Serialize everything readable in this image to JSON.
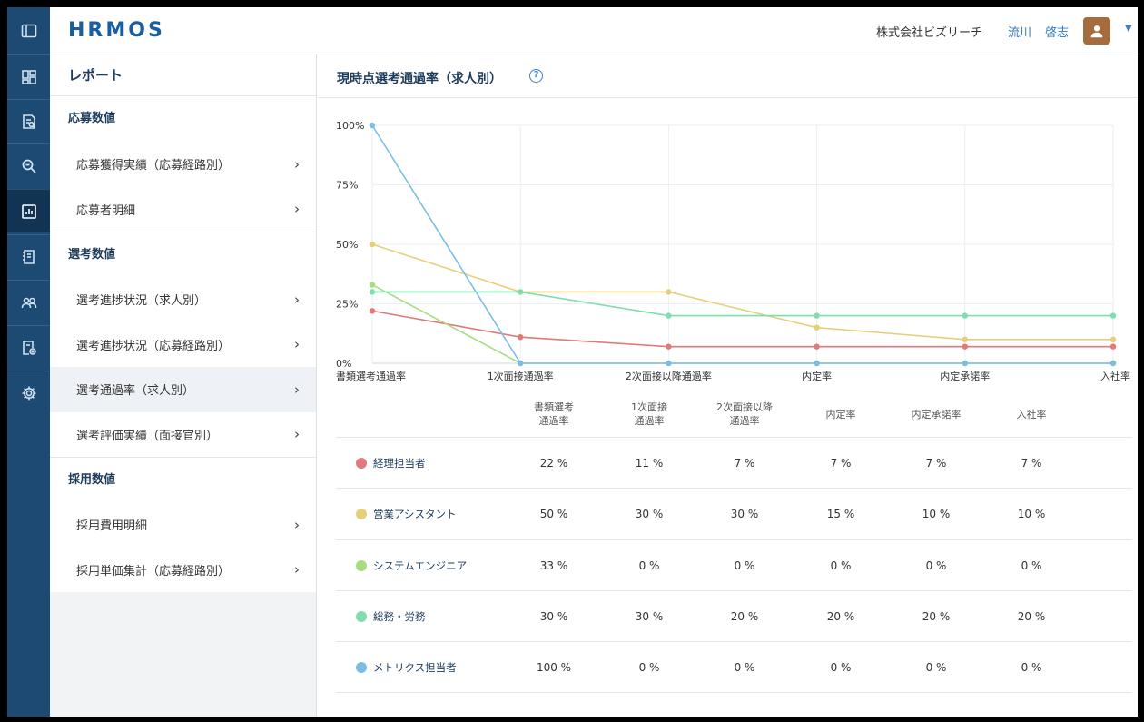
{
  "header": {
    "logo": "HRMOS",
    "company": "株式会社ビズリーチ",
    "user_last": "流川",
    "user_first": "啓志"
  },
  "rail": {
    "items": [
      "sidebar-toggle-icon",
      "dashboard-icon",
      "document-search-icon",
      "search-icon",
      "report-icon",
      "job-posting-icon",
      "people-icon",
      "settings-doc-icon",
      "gear-icon"
    ],
    "active_index": 4
  },
  "menu": {
    "title": "レポート",
    "sections": [
      {
        "heading": "応募数値",
        "items": [
          {
            "label": "応募獲得実績（応募経路別）"
          },
          {
            "label": "応募者明細"
          }
        ]
      },
      {
        "heading": "選考数値",
        "items": [
          {
            "label": "選考進捗状況（求人別）"
          },
          {
            "label": "選考進捗状況（応募経路別）"
          },
          {
            "label": "選考通過率（求人別）"
          },
          {
            "label": "選考評価実績（面接官別）"
          }
        ]
      },
      {
        "heading": "採用数値",
        "items": [
          {
            "label": "採用費用明細"
          },
          {
            "label": "採用単価集計（応募経路別）"
          }
        ]
      }
    ],
    "active_label": "選考通過率（求人別）"
  },
  "main": {
    "title": "現時点選考通過率（求人別）",
    "help": "?"
  },
  "chart_data": {
    "type": "line",
    "categories": [
      "書類選考通過率",
      "1次面接通過率",
      "2次面接以降通過率",
      "内定率",
      "内定承諾率",
      "入社率"
    ],
    "y_ticks": [
      "100%",
      "75%",
      "50%",
      "25%",
      "0%"
    ],
    "ylim": [
      0,
      100
    ],
    "grid": true,
    "series": [
      {
        "name": "経理担当者",
        "color": "#e07a7a",
        "values": [
          22,
          11,
          7,
          7,
          7,
          7
        ]
      },
      {
        "name": "営業アシスタント",
        "color": "#e6cf7a",
        "values": [
          50,
          30,
          30,
          15,
          10,
          10
        ]
      },
      {
        "name": "システムエンジニア",
        "color": "#a6dd7e",
        "values": [
          33,
          0,
          0,
          0,
          0,
          0
        ]
      },
      {
        "name": "総務・労務",
        "color": "#7fdeae",
        "values": [
          30,
          30,
          20,
          20,
          20,
          20
        ]
      },
      {
        "name": "メトリクス担当者",
        "color": "#7cbde6",
        "values": [
          100,
          0,
          0,
          0,
          0,
          0
        ]
      }
    ]
  },
  "table": {
    "headers": [
      [
        "書類選考",
        "通過率"
      ],
      [
        "1次面接",
        "通過率"
      ],
      [
        "2次面接以降",
        "通過率"
      ],
      [
        "内定率"
      ],
      [
        "内定承諾率"
      ],
      [
        "入社率"
      ]
    ],
    "rows": [
      {
        "name": "経理担当者",
        "color": "#e07a7a",
        "cells": [
          "22 %",
          "11 %",
          "7 %",
          "7 %",
          "7 %",
          "7 %"
        ]
      },
      {
        "name": "営業アシスタント",
        "color": "#e6cf7a",
        "cells": [
          "50 %",
          "30 %",
          "30 %",
          "15 %",
          "10 %",
          "10 %"
        ]
      },
      {
        "name": "システムエンジニア",
        "color": "#a6dd7e",
        "cells": [
          "33 %",
          "0 %",
          "0 %",
          "0 %",
          "0 %",
          "0 %"
        ]
      },
      {
        "name": "総務・労務",
        "color": "#7fdeae",
        "cells": [
          "30 %",
          "30 %",
          "20 %",
          "20 %",
          "20 %",
          "20 %"
        ]
      },
      {
        "name": "メトリクス担当者",
        "color": "#7cbde6",
        "cells": [
          "100 %",
          "0 %",
          "0 %",
          "0 %",
          "0 %",
          "0 %"
        ]
      }
    ]
  }
}
